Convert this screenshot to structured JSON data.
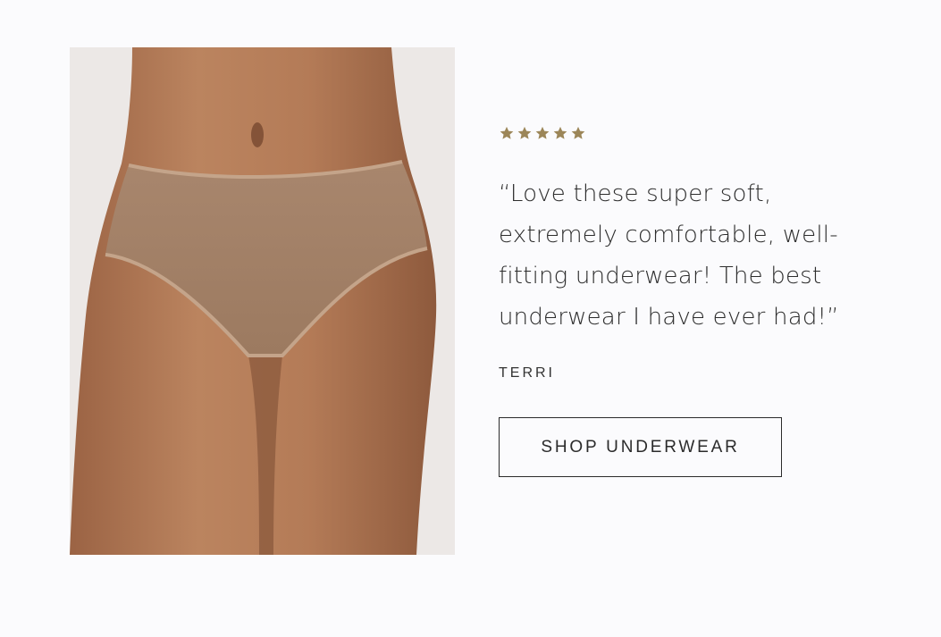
{
  "review": {
    "rating": 5,
    "max_rating": 5,
    "star_color": "#9c8658",
    "quote": "“Love these super soft, extremely comfortable, well-fitting underwear! The best underwear I have ever had!”",
    "author": "TERRI"
  },
  "cta": {
    "label": "SHOP UNDERWEAR"
  },
  "image": {
    "subject": "model-wearing-nude-underwear",
    "background_color": "#ece8e6",
    "skin_color": "#b17a55",
    "garment_color": "#a78469"
  }
}
